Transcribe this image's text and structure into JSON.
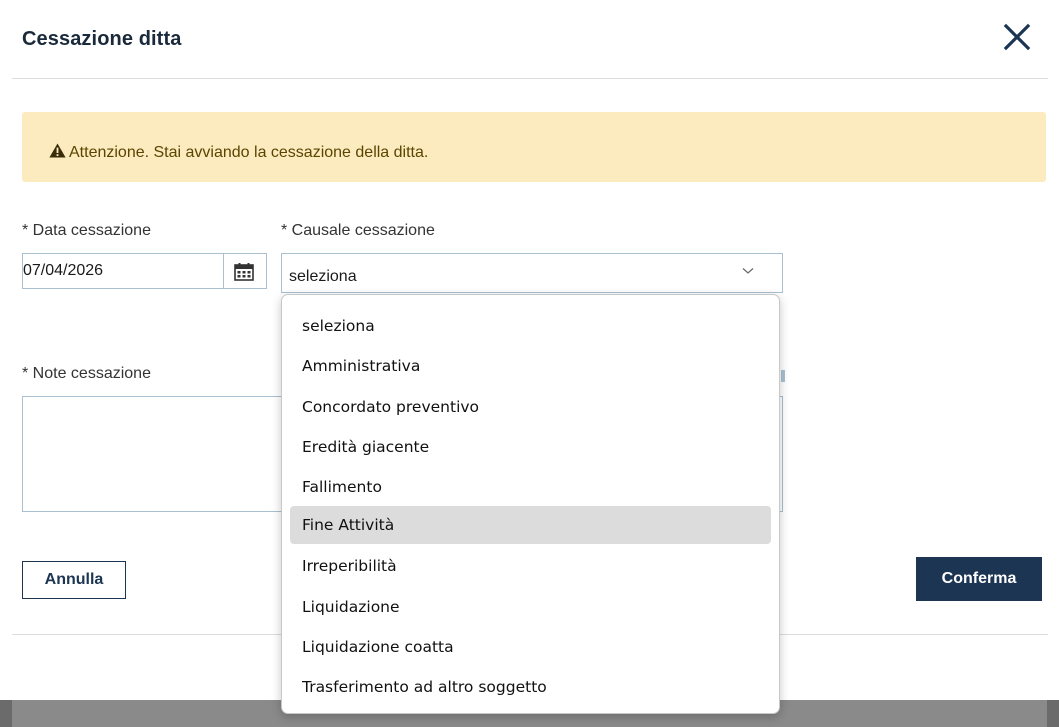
{
  "modal": {
    "title": "Cessazione ditta",
    "close_icon": "close-icon"
  },
  "alert": {
    "icon": "warning-icon",
    "text": "Attenzione. Stai avviando la cessazione della ditta.",
    "background_color": "#fcebbf"
  },
  "form": {
    "date_label": "* Data cessazione",
    "date_value": "07/04/2026",
    "calendar_icon": "calendar-icon",
    "reason_label": "* Causale cessazione",
    "reason_selected": "seleziona",
    "reason_chevron_icon": "chevron-down-icon",
    "notes_label": "* Note cessazione",
    "notes_value": ""
  },
  "dropdown": {
    "options": [
      "seleziona",
      "Amministrativa",
      "Concordato preventivo",
      "Eredità giacente",
      "Fallimento",
      "Fine Attività",
      "Irreperibilità",
      "Liquidazione",
      "Liquidazione coatta",
      "Trasferimento ad altro soggetto"
    ],
    "highlighted_option": "Fine Attività"
  },
  "buttons": {
    "cancel_label": "Annulla",
    "confirm_label": "Conferma"
  },
  "colors": {
    "primary": "#1c3553",
    "border": "#a8c0d0",
    "highlight": "#dcdcdc"
  }
}
